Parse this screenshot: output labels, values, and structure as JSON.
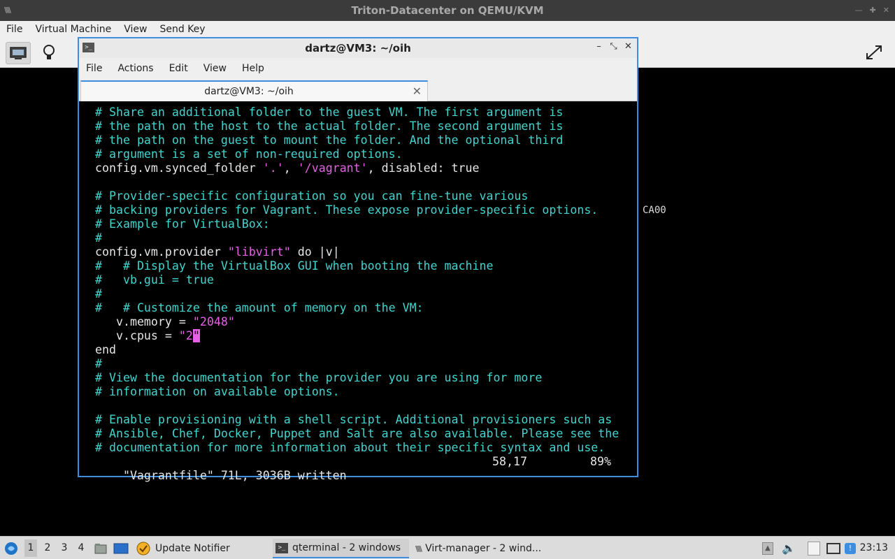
{
  "outer_window": {
    "title": "Triton-Datacenter on QEMU/KVM",
    "menu": [
      "File",
      "Virtual Machine",
      "View",
      "Send Key"
    ],
    "vm_text": "CA00"
  },
  "terminal": {
    "title": "dartz@VM3: ~/oih",
    "tab_label": "dartz@VM3: ~/oih",
    "menu": [
      "File",
      "Actions",
      "Edit",
      "View",
      "Help"
    ],
    "lines": [
      {
        "segments": [
          {
            "t": "# Share an additional folder to the guest VM. The first argument is",
            "c": "cyan"
          }
        ]
      },
      {
        "segments": [
          {
            "t": "# the path on the host to the actual folder. The second argument is",
            "c": "cyan"
          }
        ]
      },
      {
        "segments": [
          {
            "t": "# the path on the guest to mount the folder. And the optional third",
            "c": "cyan"
          }
        ]
      },
      {
        "segments": [
          {
            "t": "# argument is a set of non-required options.",
            "c": "cyan"
          }
        ]
      },
      {
        "segments": [
          {
            "t": "config.vm.synced_folder ",
            "c": "white"
          },
          {
            "t": "'.'",
            "c": "mag"
          },
          {
            "t": ", ",
            "c": "white"
          },
          {
            "t": "'/vagrant'",
            "c": "mag"
          },
          {
            "t": ", disabled: true",
            "c": "white"
          }
        ]
      },
      {
        "segments": [
          {
            "t": "",
            "c": "white"
          }
        ]
      },
      {
        "segments": [
          {
            "t": "# Provider-specific configuration so you can fine-tune various",
            "c": "cyan"
          }
        ]
      },
      {
        "segments": [
          {
            "t": "# backing providers for Vagrant. These expose provider-specific options.",
            "c": "cyan"
          }
        ]
      },
      {
        "segments": [
          {
            "t": "# Example for VirtualBox:",
            "c": "cyan"
          }
        ]
      },
      {
        "segments": [
          {
            "t": "#",
            "c": "cyan"
          }
        ]
      },
      {
        "segments": [
          {
            "t": "config.vm.provider ",
            "c": "white"
          },
          {
            "t": "\"libvirt\"",
            "c": "mag"
          },
          {
            "t": " do |v|",
            "c": "white"
          }
        ]
      },
      {
        "segments": [
          {
            "t": "#   # Display the VirtualBox GUI when booting the machine",
            "c": "cyan"
          }
        ]
      },
      {
        "segments": [
          {
            "t": "#   vb.gui = true",
            "c": "cyan"
          }
        ]
      },
      {
        "segments": [
          {
            "t": "#",
            "c": "cyan"
          }
        ]
      },
      {
        "segments": [
          {
            "t": "#   # Customize the amount of memory on the VM:",
            "c": "cyan"
          }
        ]
      },
      {
        "segments": [
          {
            "t": "   v.memory = ",
            "c": "white"
          },
          {
            "t": "\"2048\"",
            "c": "mag"
          }
        ]
      },
      {
        "segments": [
          {
            "t": "   v.cpus = ",
            "c": "white"
          },
          {
            "t": "\"2",
            "c": "mag"
          },
          {
            "t": "\"",
            "c": "cursor"
          }
        ]
      },
      {
        "segments": [
          {
            "t": "end",
            "c": "white"
          }
        ]
      },
      {
        "segments": [
          {
            "t": "#",
            "c": "cyan"
          }
        ]
      },
      {
        "segments": [
          {
            "t": "# View the documentation for the provider you are using for more",
            "c": "cyan"
          }
        ]
      },
      {
        "segments": [
          {
            "t": "# information on available options.",
            "c": "cyan"
          }
        ]
      },
      {
        "segments": [
          {
            "t": "",
            "c": "white"
          }
        ]
      },
      {
        "segments": [
          {
            "t": "# Enable provisioning with a shell script. Additional provisioners such as",
            "c": "cyan"
          }
        ]
      },
      {
        "segments": [
          {
            "t": "# Ansible, Chef, Docker, Puppet and Salt are also available. Please see the",
            "c": "cyan"
          }
        ]
      },
      {
        "segments": [
          {
            "t": "# documentation for more information about their specific syntax and use.",
            "c": "cyan"
          }
        ]
      }
    ],
    "status": {
      "file_info": "\"Vagrantfile\" 71L, 3036B written",
      "position": "58,17",
      "percent": "89%"
    }
  },
  "taskbar": {
    "workspaces": [
      "1",
      "2",
      "3",
      "4"
    ],
    "tasks": [
      {
        "label": "Update Notifier",
        "icon": "update-notifier-icon"
      },
      {
        "label": "qterminal - 2 windows",
        "icon": "terminal-icon"
      },
      {
        "label": "Virt-manager - 2 wind...",
        "icon": "virt-manager-icon"
      }
    ],
    "clock": "23:13"
  }
}
